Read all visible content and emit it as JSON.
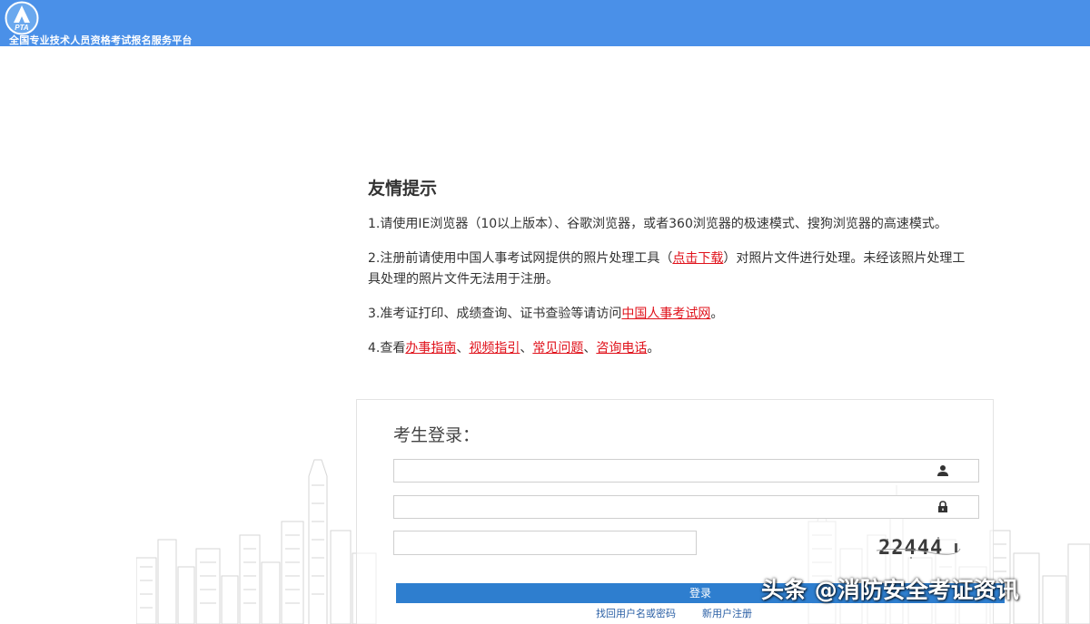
{
  "header": {
    "logo_text": "PTA",
    "site_title": "全国专业技术人员资格考试报名服务平台"
  },
  "notice": {
    "title": "友情提示",
    "item1": "1.请使用IE浏览器（10以上版本）、谷歌浏览器，或者360浏览器的极速模式、搜狗浏览器的高速模式。",
    "item2_before": "2.注册前请使用中国人事考试网提供的照片处理工具（",
    "item2_link": "点击下载",
    "item2_after": "）对照片文件进行处理。未经该照片处理工具处理的照片文件无法用于注册。",
    "item3_before": "3.准考证打印、成绩查询、证书查验等请访问",
    "item3_link": "中国人事考试网",
    "item3_after": "。",
    "item4_prefix": "4.查看",
    "item4_link1": "办事指南",
    "sep1": "、",
    "item4_link2": "视频指引",
    "sep2": "、",
    "item4_link3": "常见问题",
    "sep3": "、",
    "item4_link4": "咨询电话",
    "item4_suffix": "。"
  },
  "login": {
    "title": "考生登录：",
    "username_placeholder": "",
    "password_placeholder": "",
    "captcha_placeholder": "",
    "captcha_text": "22444",
    "submit_label": "登录",
    "forgot_label": "找回用户名或密码",
    "register_label": "新用户注册"
  },
  "watermark": "头条 @消防安全考证资讯",
  "colors": {
    "header_bg": "#4a90e8",
    "link_red": "#e0121b",
    "button_blue": "#2e7ecf",
    "link_blue": "#2a5fa5"
  },
  "icons": {
    "logo": "pta-logo",
    "username": "user-icon",
    "password": "lock-icon"
  }
}
